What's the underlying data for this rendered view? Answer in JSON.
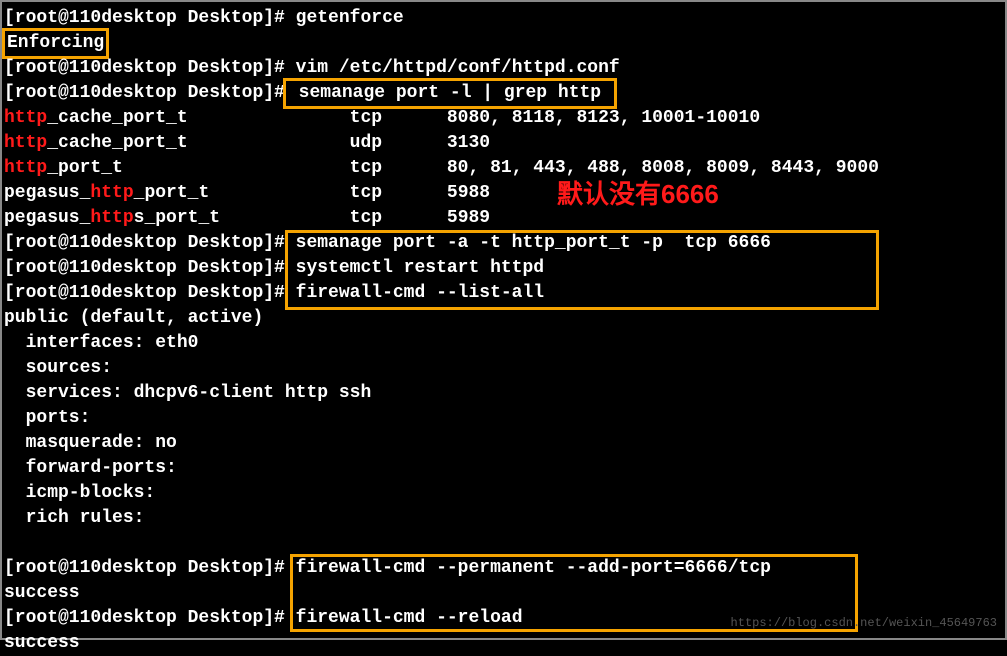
{
  "lines": {
    "l1_prompt": "[root@110desktop Desktop]# ",
    "l1_cmd": "getenforce",
    "l2_out": "Enforcing",
    "l3_prompt": "[root@110desktop Desktop]# ",
    "l3_cmd": "vim /etc/httpd/conf/httpd.conf",
    "l4_prompt": "[root@110desktop Desktop]#",
    "l4_cmd_a": " semanage port -l | grep http ",
    "l5_red": "http",
    "l5_rest": "_cache_port_t               tcp      8080, 8118, 8123, 10001-10010",
    "l6_red": "http",
    "l6_rest": "_cache_port_t               udp      3130",
    "l7_red": "http",
    "l7_rest": "_port_t                     tcp      80, 81, 443, 488, 8008, 8009, 8443, 9000",
    "l8_pre": "pegasus_",
    "l8_red": "http",
    "l8_rest": "_port_t             tcp      5988",
    "l9_pre": "pegasus_",
    "l9_red": "http",
    "l9_rest": "s_port_t            tcp      5989",
    "l10_prompt": "[root@110desktop Desktop]",
    "l10_cmd": "# semanage port -a -t http_port_t -p  tcp 6666        ",
    "l11_prompt": "[root@110desktop Desktop]",
    "l11_cmd": "# systemctl restart httpd                             ",
    "l12_prompt": "[root@110desktop Desktop]",
    "l12_cmd": "# firewall-cmd --list-all                             ",
    "l13": "public (default, active)",
    "l14": "  interfaces: eth0",
    "l15": "  sources:",
    "l16": "  services: dhcpv6-client http ssh",
    "l17": "  ports:",
    "l18": "  masquerade: no",
    "l19": "  forward-ports:",
    "l20": "  icmp-blocks:",
    "l21": "  rich rules:",
    "l22_blank": " ",
    "l23_prompt": "[root@110desktop Desktop]# ",
    "l23_cmd": "firewall-cmd --permanent --add-port=6666/tcp",
    "l24": "success",
    "l25_prompt": "[root@110desktop Desktop]# ",
    "l25_cmd": "firewall-cmd --reload",
    "l26": "success"
  },
  "annotation": "默认没有6666",
  "watermark": "https://blog.csdn.net/weixin_45649763"
}
